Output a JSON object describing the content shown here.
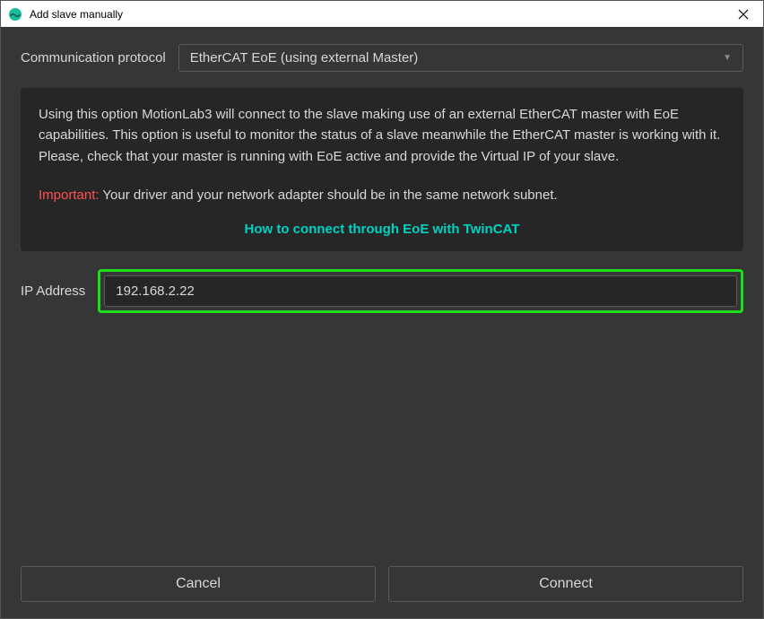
{
  "titlebar": {
    "title": "Add slave manually"
  },
  "protocol": {
    "label": "Communication protocol",
    "selected": "EtherCAT EoE (using external Master)"
  },
  "info": {
    "description": "Using this option MotionLab3 will connect to the slave making use of an external EtherCAT master with EoE capabilities. This option is useful to monitor the status of a slave meanwhile the EtherCAT master is working with it. Please, check that your master is running with EoE active and provide the Virtual IP of your slave.",
    "important_label": "Important:",
    "important_text": " Your driver and your network adapter should be in the same network subnet.",
    "help_link": "How to connect through EoE with TwinCAT"
  },
  "ip": {
    "label": "IP Address",
    "value": "192.168.2.22"
  },
  "buttons": {
    "cancel": "Cancel",
    "connect": "Connect"
  }
}
